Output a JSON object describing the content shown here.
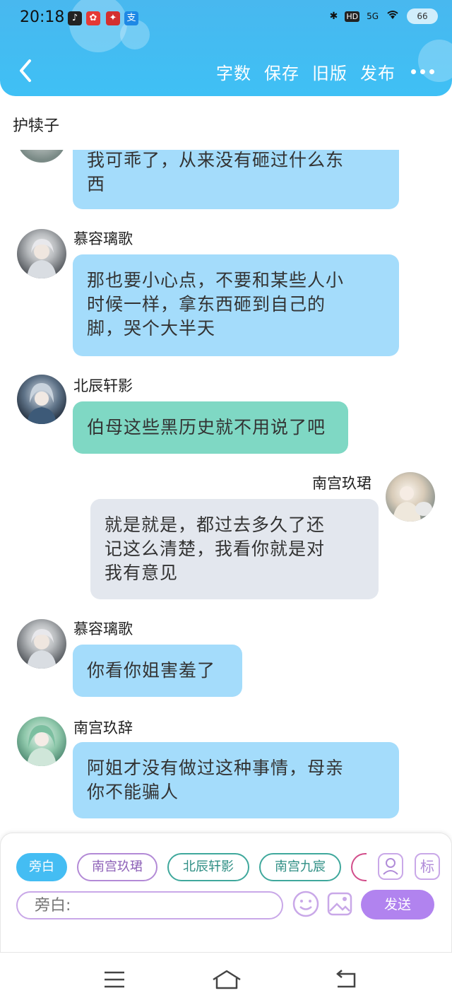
{
  "status_bar": {
    "time": "20:18",
    "network": "5G",
    "hd": "HD",
    "battery": "66"
  },
  "header": {
    "actions": [
      "字数",
      "保存",
      "旧版",
      "发布"
    ]
  },
  "chat_title": "护犊子",
  "messages": [
    {
      "speaker": "",
      "text_lines": [
        "我可乖了，从来没有砸过什么东",
        "西"
      ],
      "style": "blue",
      "side": "left"
    },
    {
      "speaker": "慕容璃歌",
      "text_lines": [
        "那也要小心点，不要和某些人小",
        "时候一样，拿东西砸到自己的",
        "脚，哭个大半天"
      ],
      "style": "blue",
      "side": "left"
    },
    {
      "speaker": "北辰轩影",
      "text_lines": [
        "伯母这些黑历史就不用说了吧"
      ],
      "style": "green",
      "side": "left"
    },
    {
      "speaker": "南宫玖珺",
      "text_lines": [
        "就是就是，都过去多久了还",
        "记这么清楚，我看你就是对",
        "我有意见"
      ],
      "style": "gray",
      "side": "right"
    },
    {
      "speaker": "慕容璃歌",
      "text_lines": [
        "你看你姐害羞了"
      ],
      "style": "blue",
      "side": "left"
    },
    {
      "speaker": "南宫玖辞",
      "text_lines": [
        "阿姐才没有做过这种事情，母亲",
        "你不能骗人"
      ],
      "style": "blue",
      "side": "left"
    }
  ],
  "role_chips": [
    "旁白",
    "南宫玖珺",
    "北辰轩影",
    "南宫九宸"
  ],
  "side_buttons": {
    "tag_label": "标"
  },
  "input": {
    "placeholder": "旁白:"
  },
  "send_label": "发送",
  "colors": {
    "header": "#48b8ef",
    "bubble_blue": "#a4dcfb",
    "bubble_green": "#7fd8c4",
    "bubble_gray": "#e3e7ee",
    "send": "#b183ef"
  }
}
